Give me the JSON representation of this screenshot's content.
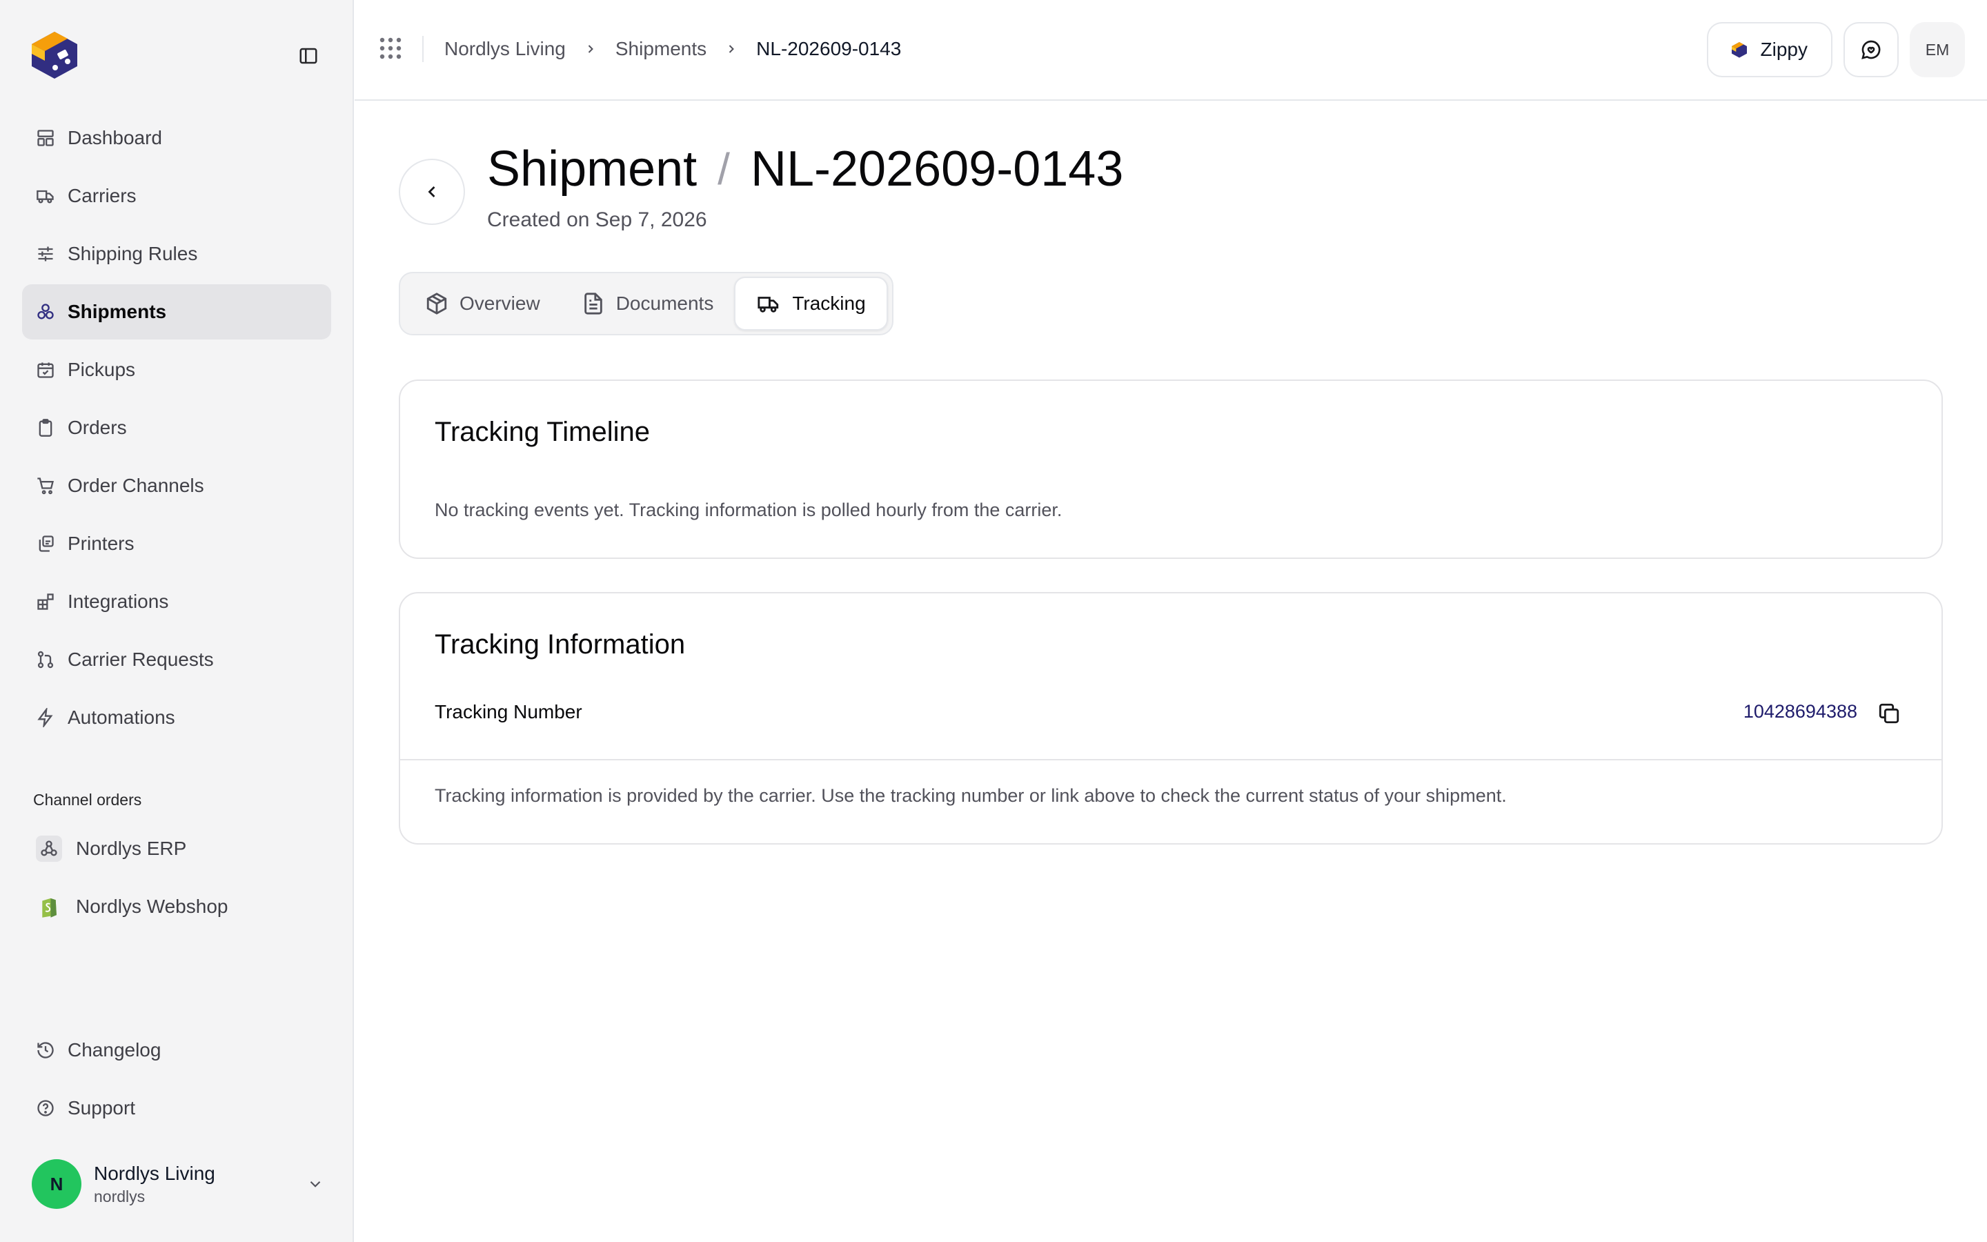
{
  "sidebar": {
    "items": [
      {
        "label": "Dashboard",
        "icon": "dashboard-icon"
      },
      {
        "label": "Carriers",
        "icon": "truck-icon"
      },
      {
        "label": "Shipping Rules",
        "icon": "sliders-icon"
      },
      {
        "label": "Shipments",
        "icon": "boxes-icon",
        "active": true
      },
      {
        "label": "Pickups",
        "icon": "calendar-check-icon"
      },
      {
        "label": "Orders",
        "icon": "clipboard-icon"
      },
      {
        "label": "Order Channels",
        "icon": "cart-icon"
      },
      {
        "label": "Printers",
        "icon": "printer-icon"
      },
      {
        "label": "Integrations",
        "icon": "blocks-icon"
      },
      {
        "label": "Carrier Requests",
        "icon": "git-pull-icon"
      },
      {
        "label": "Automations",
        "icon": "zap-icon"
      }
    ],
    "channel_section_label": "Channel orders",
    "channels": [
      {
        "label": "Nordlys ERP",
        "icon": "webhook-icon"
      },
      {
        "label": "Nordlys Webshop",
        "icon": "shopify-icon"
      }
    ],
    "bottom_items": [
      {
        "label": "Changelog",
        "icon": "history-icon"
      },
      {
        "label": "Support",
        "icon": "help-circle-icon"
      }
    ],
    "account": {
      "initial": "N",
      "name": "Nordlys Living",
      "slug": "nordlys"
    }
  },
  "topbar": {
    "breadcrumb": [
      "Nordlys Living",
      "Shipments",
      "NL-202609-0143"
    ],
    "zippy_label": "Zippy",
    "user_initials": "EM"
  },
  "page": {
    "title_prefix": "Shipment",
    "title_separator": "/",
    "shipment_id": "NL-202609-0143",
    "created": "Created on Sep 7, 2026",
    "tabs": [
      {
        "label": "Overview",
        "icon": "package-icon"
      },
      {
        "label": "Documents",
        "icon": "file-text-icon"
      },
      {
        "label": "Tracking",
        "icon": "truck-icon",
        "active": true
      }
    ]
  },
  "timeline": {
    "title": "Tracking Timeline",
    "empty_text": "No tracking events yet. Tracking information is polled hourly from the carrier."
  },
  "info": {
    "title": "Tracking Information",
    "number_label": "Tracking Number",
    "number_value": "10428694388",
    "footer_text": "Tracking information is provided by the carrier. Use the tracking number or link above to check the current status of your shipment."
  },
  "colors": {
    "accent": "#312e81",
    "logo_orange": "#f59e0b",
    "avatar_green": "#22c55e",
    "link": "#1e1b6b"
  }
}
